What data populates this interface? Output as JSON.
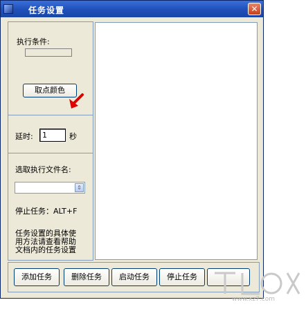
{
  "window": {
    "title": "任务设置",
    "close_label": "✕"
  },
  "left_panel": {
    "condition_label": "执行条件:",
    "pick_color_button": "取点颜色",
    "delay_label": "延时:",
    "delay_value": "1",
    "delay_unit": "秒",
    "select_file_label": "选取执行文件名:",
    "file_combo_value": "",
    "stop_hotkey_text": "停止任务：ALT+F",
    "help_text_lines": [
      "任务设置的具体使",
      "用方法请查看帮助",
      "文档内的任务设置"
    ]
  },
  "bottom_buttons": [
    "添加任务",
    "删除任务",
    "启动任务",
    "停止任务"
  ],
  "colors": {
    "title_bar": "#1F4FB9",
    "window_bg": "#ECE9D8",
    "cursor_arrow": "#E00000"
  },
  "watermark": {
    "text": "www.xz7.com"
  }
}
